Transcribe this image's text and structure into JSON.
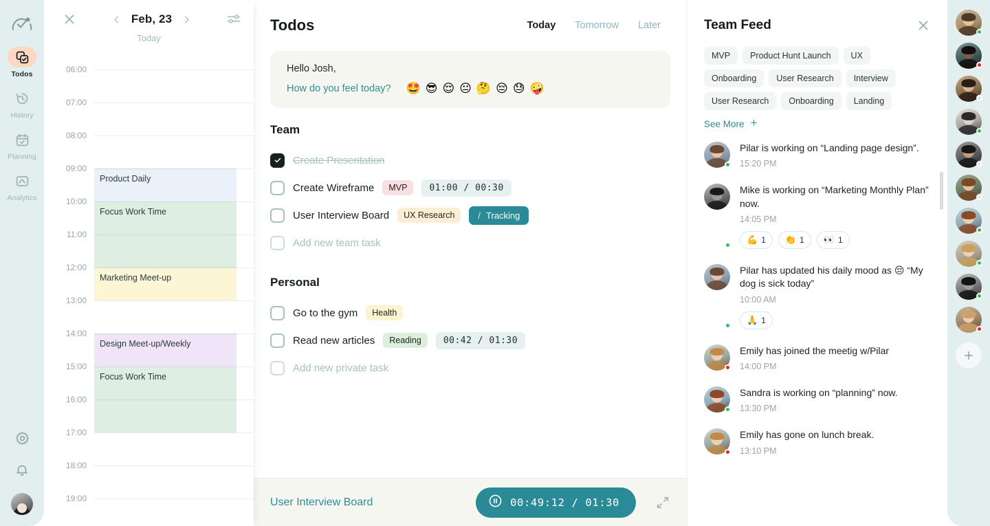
{
  "nav": {
    "logo_icon": "speedometer-logo-icon",
    "items": [
      {
        "label": "Todos",
        "icon": "copy-check-icon",
        "active": true
      },
      {
        "label": "History",
        "icon": "clock-rewind-icon",
        "active": false
      },
      {
        "label": "Planning",
        "icon": "calendar-check-icon",
        "active": false
      },
      {
        "label": "Analytics",
        "icon": "chart-wave-icon",
        "active": false
      }
    ],
    "bottom": [
      {
        "name": "settings-icon"
      },
      {
        "name": "notifications-bell-icon"
      },
      {
        "name": "user-avatar"
      }
    ]
  },
  "calendar": {
    "close_icon": "close-icon",
    "prev_icon": "chevron-left-icon",
    "next_icon": "chevron-right-icon",
    "filter_icon": "sliders-icon",
    "date": "Feb, 23",
    "subtitle": "Today",
    "hours": [
      "06:00",
      "07:00",
      "08:00",
      "09:00",
      "10:00",
      "11:00",
      "12:00",
      "13:00",
      "14:00",
      "15:00",
      "16:00",
      "17:00",
      "18:00",
      "19:00"
    ],
    "events": [
      {
        "title": "Product Daily",
        "start": "09:00",
        "end": "10:00",
        "color": "blue"
      },
      {
        "title": "Focus Work Time",
        "start": "10:00",
        "end": "12:00",
        "color": "green"
      },
      {
        "title": "Marketing Meet-up",
        "start": "12:00",
        "end": "13:00",
        "color": "yellow"
      },
      {
        "title": "Design Meet-up/Weekly",
        "start": "14:00",
        "end": "15:00",
        "color": "purple"
      },
      {
        "title": "Focus Work Time",
        "start": "15:00",
        "end": "17:00",
        "color": "green"
      }
    ]
  },
  "todos": {
    "title": "Todos",
    "tabs": [
      {
        "label": "Today",
        "active": true
      },
      {
        "label": "Tomorrow",
        "active": false
      },
      {
        "label": "Later",
        "active": false
      }
    ],
    "greeting": {
      "hello": "Hello Josh,",
      "question": "How do you feel today?",
      "moods": [
        "🤩",
        "😎",
        "😌",
        "😐",
        "🤔",
        "😔",
        "😓",
        "🤪"
      ]
    },
    "team": {
      "heading": "Team",
      "tasks": [
        {
          "name": "Create Presentation",
          "checked": true,
          "tag": null,
          "tag_style": null,
          "time": null,
          "tracking": null
        },
        {
          "name": "Create Wireframe",
          "checked": false,
          "tag": "MVP",
          "tag_style": "mvp",
          "time": "01:00 / 00:30",
          "tracking": null
        },
        {
          "name": "User Interview Board",
          "checked": false,
          "tag": "UX Research",
          "tag_style": "ux",
          "time": null,
          "tracking": "Tracking"
        }
      ],
      "add_label": "Add new team task"
    },
    "personal": {
      "heading": "Personal",
      "tasks": [
        {
          "name": "Go to the gym",
          "checked": false,
          "tag": "Health",
          "tag_style": "health",
          "time": null,
          "tracking": null
        },
        {
          "name": "Read new articles",
          "checked": false,
          "tag": "Reading",
          "tag_style": "reading",
          "time": "00:42 / 01:30",
          "tracking": null
        }
      ],
      "add_label": "Add new private task"
    },
    "timer": {
      "task": "User Interview Board",
      "pause_icon": "pause-circle-icon",
      "value": "00:49:12  /  01:30",
      "expand_icon": "expand-arrows-icon"
    }
  },
  "feed": {
    "title": "Team Feed",
    "close_icon": "close-icon",
    "tags": [
      "MVP",
      "Product Hunt Launch",
      "UX",
      "Onboarding",
      "User Research",
      "Interview",
      "User Research",
      "Onboarding",
      "Landing"
    ],
    "see_more": "See More",
    "see_more_icon": "plus-icon",
    "items": [
      {
        "text": "Pilar is working on “Landing page design”.",
        "time": "15:20 PM",
        "status": "online",
        "avatar": "pilar",
        "reactions": []
      },
      {
        "text": "Mike is working on “Marketing Monthly Plan” now.",
        "time": "14:05 PM",
        "status": "online",
        "avatar": "mike",
        "reactions": [
          {
            "emoji": "💪",
            "count": "1"
          },
          {
            "emoji": "👏",
            "count": "1"
          },
          {
            "emoji": "👀",
            "count": "1"
          }
        ]
      },
      {
        "text": "Pilar has updated his daily mood as 😔 “My dog is sick today”",
        "time": "10:00 AM",
        "status": "online",
        "avatar": "pilar",
        "reactions": [
          {
            "emoji": "🙏",
            "count": "1"
          }
        ]
      },
      {
        "text": "Emily has joined the meetig w/Pilar",
        "time": "14:00 PM",
        "status": "offline",
        "avatar": "emily",
        "reactions": []
      },
      {
        "text": "Sandra is working on “planning” now.",
        "time": "13:30 PM",
        "status": "online",
        "avatar": "sandra",
        "reactions": []
      },
      {
        "text": "Emily has gone on lunch break.",
        "time": "13:10 PM",
        "status": "offline",
        "avatar": "emily",
        "reactions": []
      }
    ]
  },
  "people_rail": {
    "people": [
      {
        "status": "online",
        "skin": "p1"
      },
      {
        "status": "offline",
        "skin": "p2"
      },
      {
        "status": "idle",
        "skin": "p3"
      },
      {
        "status": "online",
        "skin": "p4"
      },
      {
        "status": "idle",
        "skin": "p5"
      },
      {
        "status": "idle",
        "skin": "p6"
      },
      {
        "status": "online",
        "skin": "p7"
      },
      {
        "status": "online",
        "skin": "p8"
      },
      {
        "status": "online",
        "skin": "p9"
      },
      {
        "status": "offline",
        "skin": "p10"
      }
    ],
    "add_icon": "plus-icon"
  },
  "colors": {
    "accent_teal": "#2a8a96",
    "rail_bg": "#e2efee",
    "active_nav_bg": "#fbd8c4",
    "greeting_bg": "#f4f6ef",
    "timer_bar_bg": "#f5f6ef"
  }
}
